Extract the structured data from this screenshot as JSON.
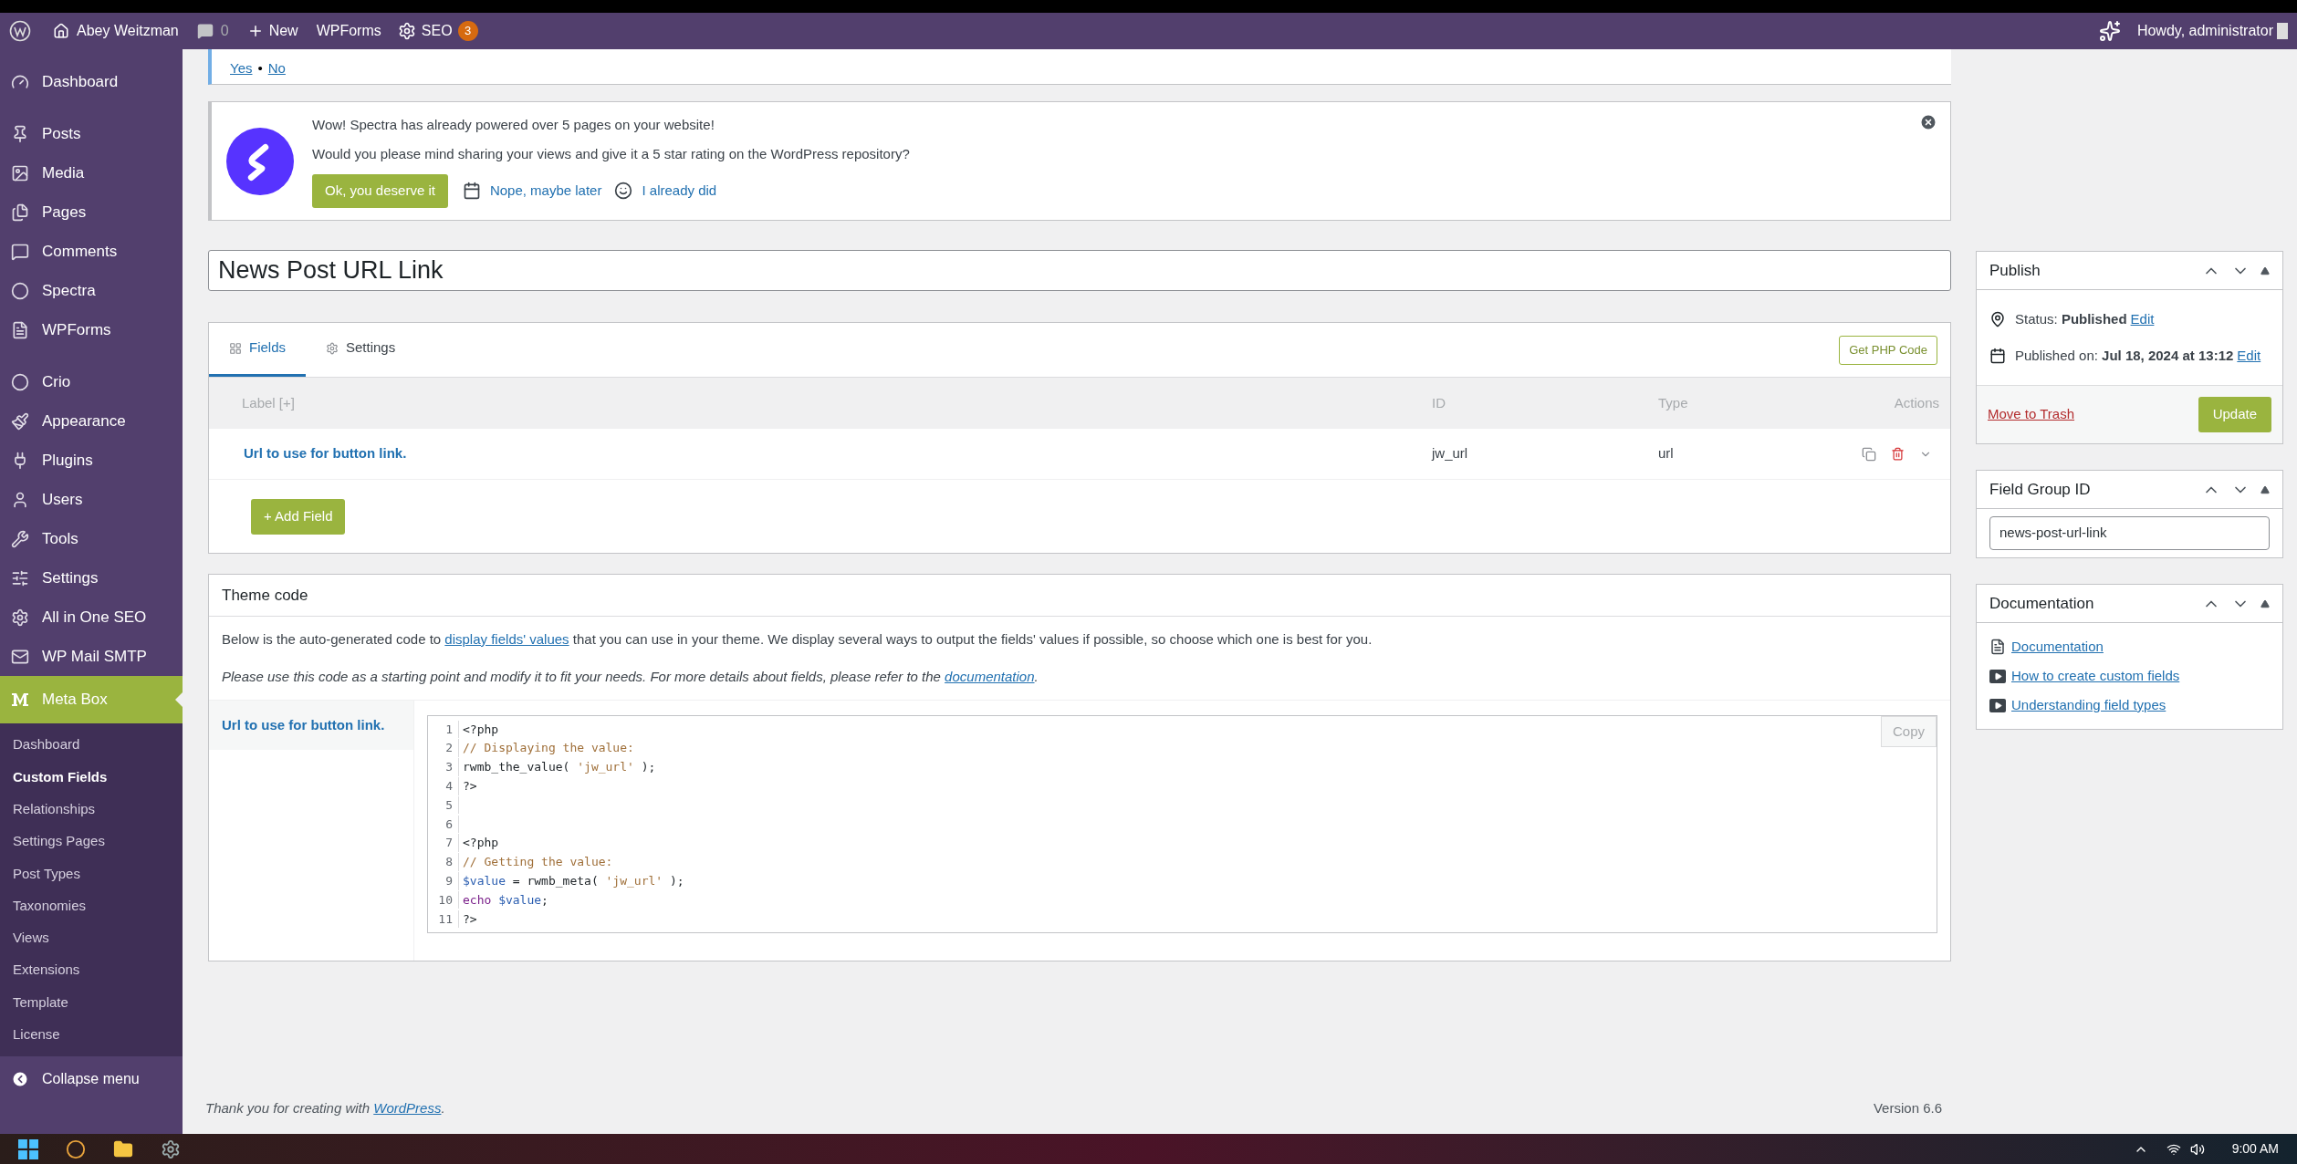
{
  "admin_bar": {
    "site": "Abey Weitzman",
    "comments": "0",
    "new": "New",
    "wpforms": "WPForms",
    "seo": "SEO",
    "seo_badge": "3",
    "greeting": "Howdy, administrator"
  },
  "sidebar": {
    "items": [
      {
        "label": "Dashboard",
        "selected": false
      },
      {
        "label": "Posts",
        "selected": false
      },
      {
        "label": "Media",
        "selected": false
      },
      {
        "label": "Pages",
        "selected": false
      },
      {
        "label": "Comments",
        "selected": false
      },
      {
        "label": "Spectra",
        "selected": false
      },
      {
        "label": "WPForms",
        "selected": false
      },
      {
        "label": "Crio",
        "selected": false
      },
      {
        "label": "Appearance",
        "selected": false
      },
      {
        "label": "Plugins",
        "selected": false
      },
      {
        "label": "Users",
        "selected": false
      },
      {
        "label": "Tools",
        "selected": false
      },
      {
        "label": "Settings",
        "selected": false
      },
      {
        "label": "All in One SEO",
        "selected": false
      },
      {
        "label": "WP Mail SMTP",
        "selected": false
      },
      {
        "label": "Meta Box",
        "selected": true
      }
    ],
    "submenu": [
      {
        "label": "Dashboard",
        "selected": false
      },
      {
        "label": "Custom Fields",
        "selected": true
      },
      {
        "label": "Relationships",
        "selected": false
      },
      {
        "label": "Settings Pages",
        "selected": false
      },
      {
        "label": "Post Types",
        "selected": false
      },
      {
        "label": "Taxonomies",
        "selected": false
      },
      {
        "label": "Views",
        "selected": false
      },
      {
        "label": "Extensions",
        "selected": false
      },
      {
        "label": "Template",
        "selected": false
      },
      {
        "label": "License",
        "selected": false
      }
    ],
    "collapse": "Collapse menu"
  },
  "feedback_notice": {
    "yes": "Yes",
    "separator": "•",
    "no": "No"
  },
  "spectra_notice": {
    "line1": "Wow! Spectra has already powered over 5 pages on your website!",
    "line2": "Would you please mind sharing your views and give it a 5 star rating on the WordPress repository?",
    "button": "Ok, you deserve it",
    "later": "Nope, maybe later",
    "done": "I already did"
  },
  "title": "News Post URL Link",
  "fields_panel": {
    "tabs": [
      {
        "label": "Fields",
        "selected": true
      },
      {
        "label": "Settings",
        "selected": false
      }
    ],
    "php_button": "Get PHP Code",
    "columns": [
      "Label [+]",
      "ID",
      "Type",
      "Actions"
    ],
    "rows": [
      {
        "label": "Url to use for button link.",
        "id": "jw_url",
        "type": "url"
      }
    ],
    "add_button": "+ Add Field"
  },
  "theme_code": {
    "title": "Theme code",
    "intro_before": "Below is the auto-generated code to ",
    "intro_link": "display fields' values",
    "intro_after": " that you can use in your theme. We display several ways to output the fields' values if possible, so choose which one is best for you.",
    "note_before": "Please use this code as a starting point and modify it to fit your needs. For more details about fields, please refer to the ",
    "note_link": "documentation",
    "note_after": ".",
    "field": "Url to use for button link.",
    "copy": "Copy",
    "lines": [
      {
        "number": "1",
        "tokens": [
          {
            "kind": "plain",
            "text": "<?php"
          }
        ]
      },
      {
        "number": "2",
        "tokens": [
          {
            "kind": "comment",
            "text": "// Displaying the value:"
          }
        ]
      },
      {
        "number": "3",
        "tokens": [
          {
            "kind": "plain",
            "text": "rwmb_the_value( "
          },
          {
            "kind": "string",
            "text": "'jw_url'"
          },
          {
            "kind": "plain",
            "text": " );"
          }
        ]
      },
      {
        "number": "4",
        "tokens": [
          {
            "kind": "plain",
            "text": "?>"
          }
        ]
      },
      {
        "number": "5"
      },
      {
        "number": "6"
      },
      {
        "number": "7",
        "tokens": [
          {
            "kind": "plain",
            "text": "<?php"
          }
        ]
      },
      {
        "number": "8",
        "tokens": [
          {
            "kind": "comment",
            "text": "// Getting the value:"
          }
        ]
      },
      {
        "number": "9",
        "tokens": [
          {
            "kind": "variable",
            "text": "$value"
          },
          {
            "kind": "plain",
            "text": " = rwmb_meta( "
          },
          {
            "kind": "string",
            "text": "'jw_url'"
          },
          {
            "kind": "plain",
            "text": " );"
          }
        ]
      },
      {
        "number": "10",
        "tokens": [
          {
            "kind": "keyword",
            "text": "echo "
          },
          {
            "kind": "variable",
            "text": "$value"
          },
          {
            "kind": "plain",
            "text": ";"
          }
        ]
      },
      {
        "number": "11",
        "tokens": [
          {
            "kind": "plain",
            "text": "?>"
          }
        ]
      }
    ]
  },
  "publish_box": {
    "title": "Publish",
    "status_label": "Status:",
    "status": "Published",
    "status_edit": "Edit",
    "date_label": "Published on:",
    "date": "Jul 18, 2024 at 13:12",
    "date_edit": "Edit",
    "trash": "Move to Trash",
    "update": "Update"
  },
  "group_id_box": {
    "title": "Field Group ID",
    "value": "news-post-url-link"
  },
  "documentation_box": {
    "title": "Documentation",
    "links": [
      {
        "kind": "document",
        "label": "Documentation"
      },
      {
        "kind": "video",
        "label": "How to create custom fields"
      },
      {
        "kind": "video",
        "label": "Understanding field types"
      }
    ]
  },
  "footer": {
    "before": "Thank you for creating with ",
    "link": "WordPress",
    "after": ".",
    "version": "Version 6.6"
  },
  "taskbar": {
    "time": "9:00 AM"
  }
}
